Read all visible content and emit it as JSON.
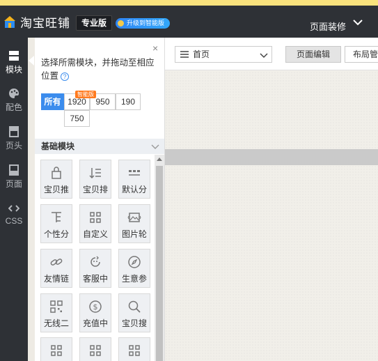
{
  "app": {
    "title": "淘宝旺铺",
    "edition": "专业版",
    "upgrade_label": "升级到智能版",
    "page_decor_label": "页面装修"
  },
  "leftnav": {
    "items": [
      {
        "label": "模块",
        "icon": "module-icon",
        "active": true
      },
      {
        "label": "配色",
        "icon": "palette-icon",
        "active": false
      },
      {
        "label": "页头",
        "icon": "page-header-icon",
        "active": false
      },
      {
        "label": "页面",
        "icon": "page-icon",
        "active": false
      },
      {
        "label": "CSS",
        "icon": "css-code-icon",
        "active": false
      }
    ]
  },
  "panel": {
    "description": "选择所需模块，并拖动至相应位置",
    "help_icon": "question-icon",
    "smart_tag": "智能版",
    "filters": [
      {
        "label": "所有",
        "active": true
      },
      {
        "label": "1920",
        "active": false
      },
      {
        "label": "950",
        "active": false
      },
      {
        "label": "190",
        "active": false
      },
      {
        "label": "750",
        "active": false
      }
    ],
    "section_title": "基础模块",
    "modules": [
      {
        "label": "宝贝推",
        "icon": "bag-icon"
      },
      {
        "label": "宝贝排",
        "icon": "sort-list-icon"
      },
      {
        "label": "默认分",
        "icon": "category-icon"
      },
      {
        "label": "个性分",
        "icon": "tree-icon"
      },
      {
        "label": "自定义",
        "icon": "grid-icon"
      },
      {
        "label": "图片轮",
        "icon": "image-carousel-icon"
      },
      {
        "label": "友情链",
        "icon": "link-icon"
      },
      {
        "label": "客服中",
        "icon": "customer-service-icon"
      },
      {
        "label": "生意参",
        "icon": "compass-icon"
      },
      {
        "label": "无线二",
        "icon": "qrcode-icon"
      },
      {
        "label": "充值中",
        "icon": "dollar-icon"
      },
      {
        "label": "宝贝搜",
        "icon": "search-icon"
      },
      {
        "label": "",
        "icon": "grid-icon"
      },
      {
        "label": "",
        "icon": "grid-icon"
      },
      {
        "label": "",
        "icon": "grid-icon"
      }
    ]
  },
  "editor": {
    "page_select_value": "首页",
    "tabs": [
      {
        "label": "页面编辑",
        "active": true
      },
      {
        "label": "布局管",
        "active": false
      }
    ]
  },
  "colors": {
    "accent": "#3b8ced",
    "topbar": "#2e3136",
    "top_stripe": "#f9e27d",
    "smart_tag": "#ff7a1e"
  }
}
